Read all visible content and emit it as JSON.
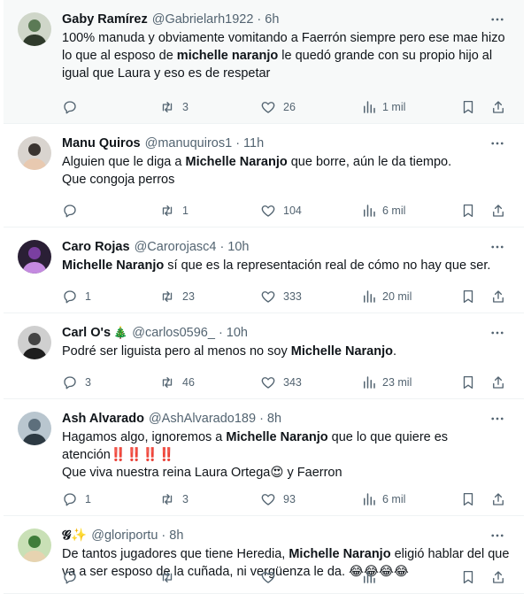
{
  "feed": {
    "tweets": [
      {
        "name": "Gaby Ramírez",
        "emoji": "",
        "handle": "@Gabrielarh1922",
        "time": "6h",
        "segments": [
          {
            "t": "100% manuda y obviamente vomitando a Faerrón siempre pero ese mae hizo lo que al esposo de ",
            "b": false
          },
          {
            "t": "michelle naranjo",
            "b": true
          },
          {
            "t": " le quedó grande con su propio hijo al igual que Laura y eso es de respetar",
            "b": false
          }
        ],
        "replies": "",
        "retweets": "3",
        "likes": "26",
        "views": "1 mil"
      },
      {
        "name": "Manu Quiros",
        "emoji": "",
        "handle": "@manuquiros1",
        "time": "11h",
        "segments": [
          {
            "t": "Alguien que le diga a ",
            "b": false
          },
          {
            "t": "Michelle Naranjo",
            "b": true
          },
          {
            "t": " que borre, aún le da tiempo.\nQue congoja perros",
            "b": false
          }
        ],
        "replies": "",
        "retweets": "1",
        "likes": "104",
        "views": "6 mil"
      },
      {
        "name": "Caro Rojas",
        "emoji": "",
        "handle": "@Carorojasc4",
        "time": "10h",
        "segments": [
          {
            "t": "Michelle Naranjo",
            "b": true
          },
          {
            "t": " sí que es la representación real de cómo no hay que ser.",
            "b": false
          }
        ],
        "replies": "1",
        "retweets": "23",
        "likes": "333",
        "views": "20 mil"
      },
      {
        "name": "Carl O's",
        "emoji": "🎄",
        "handle": "@carlos0596_",
        "time": "10h",
        "segments": [
          {
            "t": "Podré ser liguista pero al menos no soy ",
            "b": false
          },
          {
            "t": "Michelle Naranjo",
            "b": true
          },
          {
            "t": ".",
            "b": false
          }
        ],
        "replies": "3",
        "retweets": "46",
        "likes": "343",
        "views": "23 mil"
      },
      {
        "name": "Ash Alvarado",
        "emoji": "",
        "handle": "@AshAlvarado189",
        "time": "8h",
        "segments": [
          {
            "t": "Hagamos algo, ignoremos a ",
            "b": false
          },
          {
            "t": "Michelle Naranjo",
            "b": true
          },
          {
            "t": " que lo que quiere es atención‼️‼️‼️‼️\nQue viva nuestra reina Laura Ortega😍 y Faerron",
            "b": false
          }
        ],
        "replies": "1",
        "retweets": "3",
        "likes": "93",
        "views": "6 mil"
      },
      {
        "name": "𝓖✨",
        "emoji": "",
        "handle": "@gloriportu",
        "time": "8h",
        "segments": [
          {
            "t": "De tantos jugadores que tiene Heredia, ",
            "b": false
          },
          {
            "t": "Michelle Naranjo",
            "b": true
          },
          {
            "t": " eligió hablar del que va a ser esposo de la cuñada, ni vergüenza le da. 😂😂😂😂",
            "b": false
          }
        ],
        "replies": "",
        "retweets": "",
        "likes": "",
        "views": ""
      }
    ]
  },
  "colors": {
    "text": "#0f1419",
    "secondary": "#536471",
    "divider": "#eff3f4",
    "top_row_bg": "#f7f9f9"
  },
  "icons": {
    "avatar": "avatar",
    "more": "more-icon",
    "reply": "reply-icon",
    "retweet": "retweet-icon",
    "like": "like-icon",
    "views": "views-icon",
    "bookmark": "bookmark-icon",
    "share": "share-icon"
  }
}
